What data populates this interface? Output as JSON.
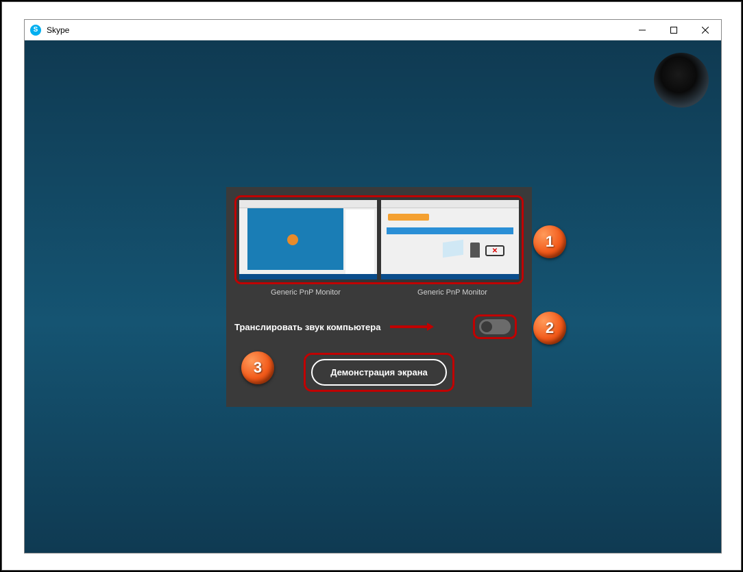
{
  "window": {
    "title": "Skype"
  },
  "dialog": {
    "monitors": [
      {
        "label": "Generic PnP Monitor"
      },
      {
        "label": "Generic PnP Monitor"
      }
    ],
    "audio_toggle_label": "Транслировать звук компьютера",
    "share_button_label": "Демонстрация экрана"
  },
  "callouts": {
    "one": "1",
    "two": "2",
    "three": "3"
  }
}
